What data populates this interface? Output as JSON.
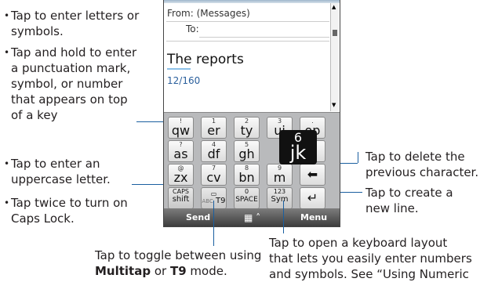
{
  "callouts": {
    "left1": "Tap to enter letters or symbols.",
    "left2": [
      "Tap and hold to enter",
      "a punctuation mark,",
      "symbol, or number",
      "that appears on top",
      "of a key"
    ],
    "left3": [
      "Tap to enter an",
      "uppercase letter."
    ],
    "left4": [
      "Tap twice to turn on",
      "Caps Lock."
    ],
    "right1": [
      "Tap to delete the",
      "previous character."
    ],
    "right2": [
      "Tap to create a",
      "new line."
    ],
    "bottom1_line1": "Tap to toggle between using",
    "bottom1_bold1": "Multitap",
    "bottom1_mid": " or ",
    "bottom1_bold2": "T9",
    "bottom1_end": " mode.",
    "bottom2": [
      "Tap to open a keyboard layout",
      "that lets you easily enter numbers",
      "and symbols. See “Using Numeric"
    ]
  },
  "phone": {
    "from_label": "From:",
    "from_value": "(Messages)",
    "to_label": "To:",
    "subject": "The reports",
    "counter": "12/160",
    "keys": [
      {
        "top": "!",
        "main": "qw"
      },
      {
        "top": "1",
        "main": "er"
      },
      {
        "top": "2",
        "main": "ty"
      },
      {
        "top": "3",
        "main": "ui"
      },
      {
        "top": ".",
        "main": "op"
      },
      {
        "top": "?",
        "main": "as"
      },
      {
        "top": "4",
        "main": "df"
      },
      {
        "top": "5",
        "main": "gh"
      },
      {
        "top": "",
        "main": ""
      },
      {
        "top": "",
        "main": "l"
      },
      {
        "top": "@",
        "main": "zx"
      },
      {
        "top": "7",
        "main": "cv"
      },
      {
        "top": "8",
        "main": "bn"
      },
      {
        "top": "9",
        "main": "m"
      }
    ],
    "popup_top": "6",
    "popup_main": "jk",
    "caps_label": "CAPS",
    "shift_label": "shift",
    "abc_label": "ABC",
    "t9_label": "T9",
    "zero": "0",
    "space_label": "SPACE",
    "num_top": "123",
    "sym_label": "Sym",
    "backspace_icon": "⬅",
    "enter_icon": "↵",
    "softkey_left": "Send",
    "softkey_right": "Menu",
    "grid_icon": "▦ ˄"
  }
}
